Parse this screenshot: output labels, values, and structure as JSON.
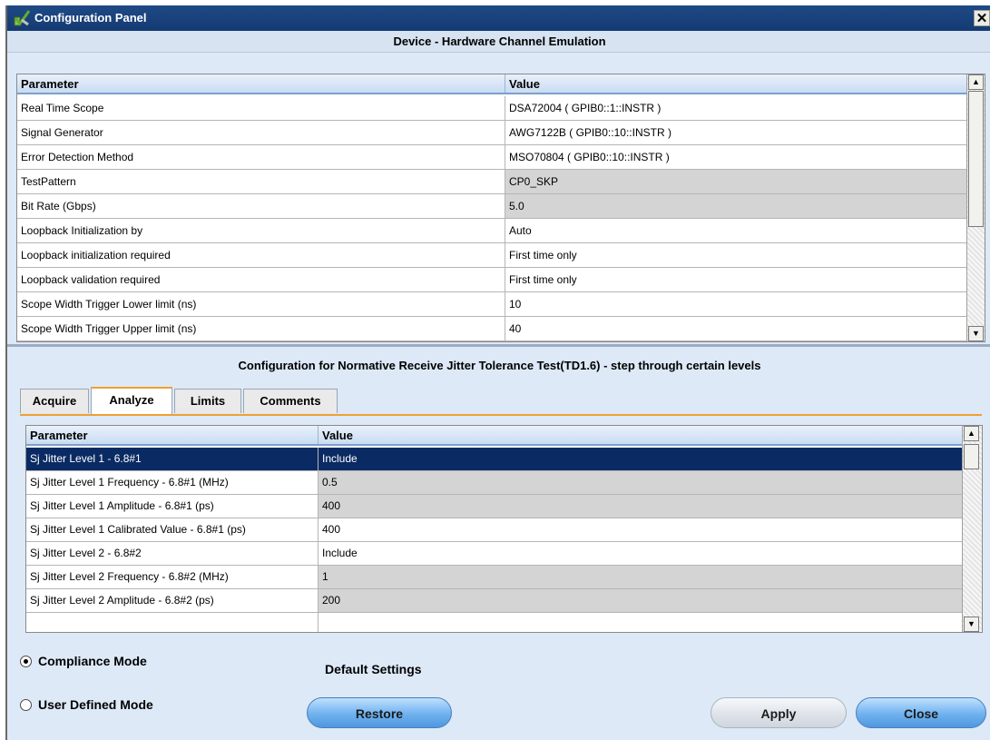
{
  "window": {
    "title": "Configuration Panel",
    "close_glyph": "✕",
    "icon": "checkmark-wrench-icon"
  },
  "device": {
    "header": "Device - Hardware Channel Emulation",
    "col_parameter": "Parameter",
    "col_value": "Value",
    "rows": [
      {
        "p": "Real Time Scope",
        "v": "DSA72004 ( GPIB0::1::INSTR )",
        "gray": false
      },
      {
        "p": "Signal Generator",
        "v": "AWG7122B ( GPIB0::10::INSTR )",
        "gray": false
      },
      {
        "p": "Error Detection Method",
        "v": "MSO70804 ( GPIB0::10::INSTR )",
        "gray": false
      },
      {
        "p": "TestPattern",
        "v": "CP0_SKP",
        "gray": true
      },
      {
        "p": "Bit Rate (Gbps)",
        "v": "5.0",
        "gray": true
      },
      {
        "p": "Loopback Initialization by",
        "v": "Auto",
        "gray": false
      },
      {
        "p": "Loopback initialization required",
        "v": "First time only",
        "gray": false
      },
      {
        "p": "Loopback validation required",
        "v": "First time only",
        "gray": false
      },
      {
        "p": "Scope Width Trigger Lower limit (ns)",
        "v": "10",
        "gray": false
      },
      {
        "p": "Scope Width Trigger Upper limit (ns)",
        "v": "40",
        "gray": false
      }
    ]
  },
  "config": {
    "header": "Configuration for Normative Receive Jitter Tolerance Test(TD1.6) - step through certain levels",
    "tabs": [
      "Acquire",
      "Analyze",
      "Limits",
      "Comments"
    ],
    "active_tab": "Analyze",
    "col_parameter": "Parameter",
    "col_value": "Value",
    "rows": [
      {
        "p": "Sj Jitter Level 1 - 6.8#1",
        "v": "Include",
        "gray": false,
        "selected": true
      },
      {
        "p": "Sj Jitter Level 1 Frequency - 6.8#1 (MHz)",
        "v": "0.5",
        "gray": true,
        "selected": false
      },
      {
        "p": "Sj Jitter Level 1 Amplitude - 6.8#1 (ps)",
        "v": "400",
        "gray": true,
        "selected": false
      },
      {
        "p": "Sj Jitter Level 1 Calibrated Value - 6.8#1 (ps)",
        "v": "400",
        "gray": false,
        "selected": false
      },
      {
        "p": "Sj Jitter Level 2 - 6.8#2",
        "v": "Include",
        "gray": false,
        "selected": false
      },
      {
        "p": "Sj Jitter Level 2 Frequency - 6.8#2 (MHz)",
        "v": "1",
        "gray": true,
        "selected": false
      },
      {
        "p": "Sj Jitter Level 2 Amplitude - 6.8#2 (ps)",
        "v": "200",
        "gray": true,
        "selected": false
      },
      {
        "p": "",
        "v": "",
        "gray": false,
        "selected": false
      }
    ]
  },
  "modes": {
    "compliance": "Compliance Mode",
    "user_defined": "User Defined Mode",
    "selected": "compliance"
  },
  "defaults": {
    "label": "Default Settings",
    "restore": "Restore"
  },
  "buttons": {
    "apply": "Apply",
    "close": "Close"
  }
}
